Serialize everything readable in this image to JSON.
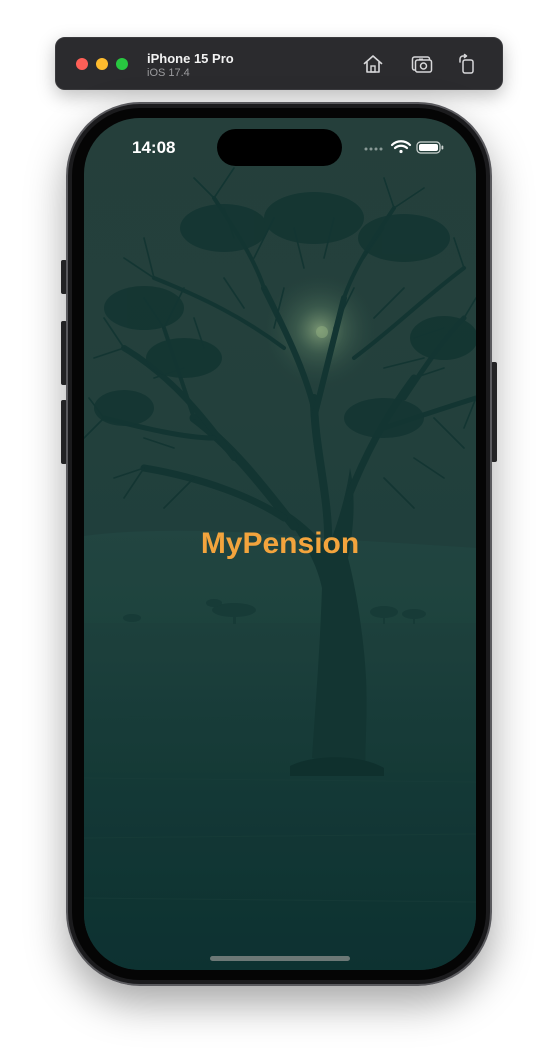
{
  "simulator": {
    "device_name": "iPhone 15 Pro",
    "os_version": "iOS 17.4",
    "toolbar_icons": [
      "home-icon",
      "screenshot-icon",
      "rotate-icon"
    ]
  },
  "status_bar": {
    "time": "14:08",
    "icons": [
      "cellular-dots-icon",
      "wifi-icon",
      "battery-icon"
    ]
  },
  "app": {
    "title": "MyPension",
    "title_color": "#f3a43d",
    "background_tint": "#173835",
    "background_image": "savanna-acacia-tree"
  }
}
